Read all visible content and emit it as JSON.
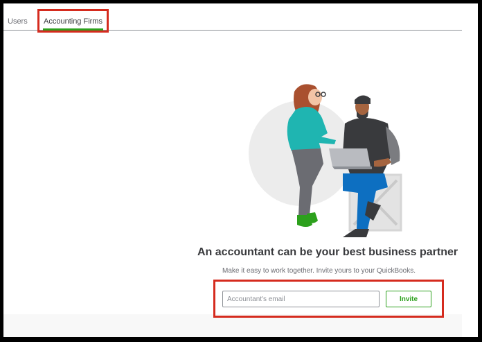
{
  "tabs": [
    {
      "label": "Users"
    },
    {
      "label": "Accounting Firms"
    }
  ],
  "main": {
    "headline": "An accountant can be your best business partner",
    "subtext": "Make it easy to work together. Invite yours to your QuickBooks.",
    "email_placeholder": "Accountant's email",
    "invite_label": "Invite"
  },
  "colors": {
    "active_tab_underline": "#2ca01c",
    "invite_button": "#2ca01c",
    "highlight_box": "#d52b1e"
  }
}
